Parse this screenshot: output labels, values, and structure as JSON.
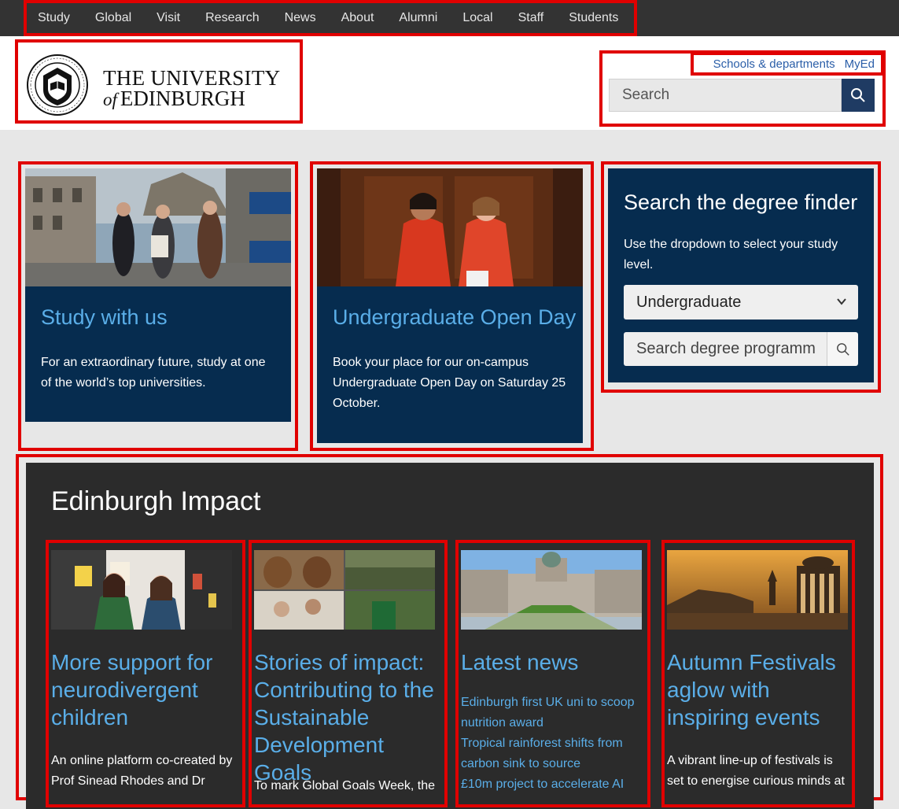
{
  "top_nav": {
    "items": [
      "Study",
      "Global",
      "Visit",
      "Research",
      "News",
      "About",
      "Alumni",
      "Local",
      "Staff",
      "Students"
    ]
  },
  "header": {
    "logo_line1": "THE UNIVERSITY",
    "logo_of": "of",
    "logo_line2": "EDINBURGH",
    "utility_links": [
      "Schools & departments",
      "MyEd"
    ],
    "search_placeholder": "Search"
  },
  "cards": [
    {
      "title": "Study with us",
      "text": "For an extraordinary future, study at one of the world’s top universities."
    },
    {
      "title": "Undergraduate Open Day",
      "text": "Book your place for our on-campus Undergraduate Open Day on Saturday 25 October."
    }
  ],
  "degree_finder": {
    "title": "Search the degree finder",
    "help": "Use the dropdown to select your study level.",
    "selected_level": "Undergraduate",
    "search_placeholder": "Search degree programm"
  },
  "impact": {
    "title": "Edinburgh Impact",
    "items": [
      {
        "title": "More support for neurodivergent children",
        "text": "An online platform co-created by Prof Sinead Rhodes and Dr"
      },
      {
        "title": "Stories of impact: Contributing to the Sustainable Development Goals",
        "text": "To mark Global Goals Week, the"
      },
      {
        "title": "Latest news",
        "links": [
          "Edinburgh first UK uni to scoop nutrition award",
          "Tropical rainforest shifts from carbon sink to source",
          "£10m project to accelerate AI"
        ]
      },
      {
        "title": "Autumn Festivals aglow with inspiring events",
        "text": "A vibrant line-up of festivals is set to energise curious minds at"
      }
    ]
  },
  "colors": {
    "top_nav_bg": "#333333",
    "card_bg": "#062c4f",
    "card_title": "#5aaee8",
    "impact_bg": "#2b2b2b",
    "link_blue": "#2a5ea8",
    "highlight": "#e00000"
  }
}
